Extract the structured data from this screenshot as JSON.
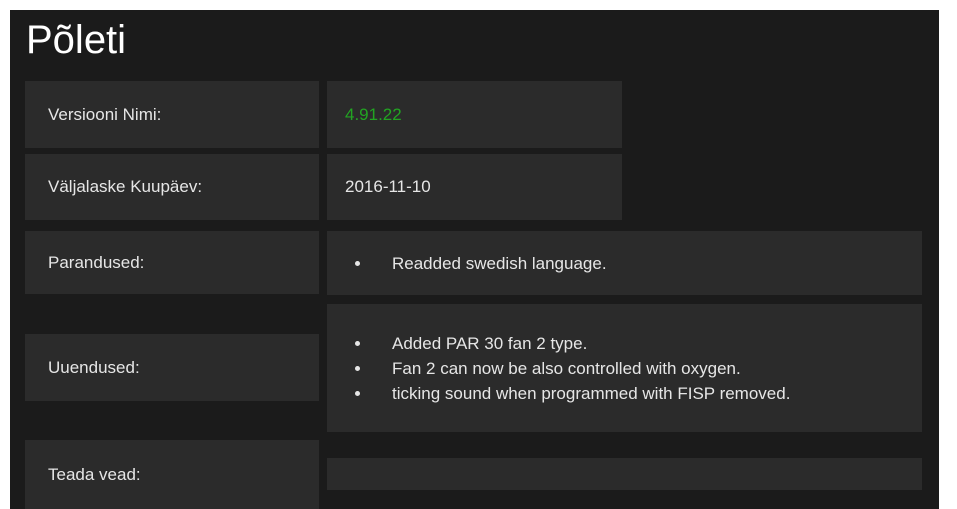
{
  "page": {
    "title": "Põleti"
  },
  "rows": {
    "version": {
      "label": "Versiooni Nimi:",
      "value": "4.91.22"
    },
    "release": {
      "label": "Väljalaske Kuupäev:",
      "value": "2016-11-10"
    },
    "fixes": {
      "label": "Parandused:",
      "items": [
        "Readded swedish language."
      ]
    },
    "updates": {
      "label": "Uuendused:",
      "items": [
        "Added PAR 30 fan 2 type.",
        "Fan 2 can now be also controlled with oxygen.",
        "ticking sound when programmed with FISP removed."
      ]
    },
    "known_bugs": {
      "label": "Teada vead:",
      "value": ""
    }
  },
  "colors": {
    "version_value": "#22a422",
    "background": "#1b1b1b",
    "cell": "#2b2b2b"
  }
}
